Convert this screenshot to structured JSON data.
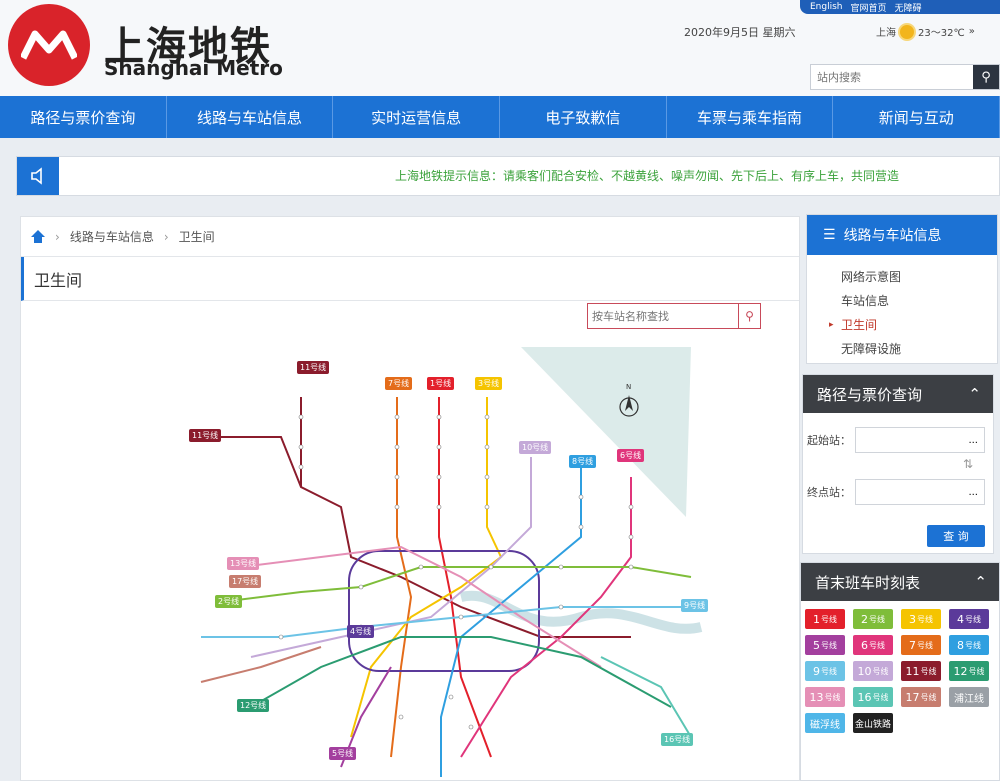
{
  "header": {
    "brand_cn": "上海地铁",
    "brand_en": "Shanghai Metro",
    "toplinks": [
      "English",
      "官网首页",
      "无障碍"
    ],
    "date": "2020年9月5日  星期六",
    "weather_city": "上海",
    "weather_temp": "23～32℃",
    "weather_more": "»",
    "search_placeholder": "站内搜索"
  },
  "nav": {
    "items": [
      "路径与票价查询",
      "线路与车站信息",
      "实时运营信息",
      "电子致歉信",
      "车票与乘车指南",
      "新闻与互动"
    ]
  },
  "notice": {
    "text": "上海地铁提示信息：请乘客们配合安检、不越黄线、噪声勿闻、先下后上、有序上车，共同营造"
  },
  "breadcrumb": [
    "线路与车站信息",
    "卫生间"
  ],
  "page_title": "卫生间",
  "station_search_placeholder": "按车站名称查找",
  "map": {
    "north": "N",
    "badges": [
      {
        "label": "11号线",
        "color": "#8b1c2c"
      },
      {
        "label": "11号线",
        "color": "#8b1c2c"
      },
      {
        "label": "7号线",
        "color": "#e46c1a"
      },
      {
        "label": "1号线",
        "color": "#e3202b"
      },
      {
        "label": "3号线",
        "color": "#f5c400"
      },
      {
        "label": "10号线",
        "color": "#c4a9d8"
      },
      {
        "label": "8号线",
        "color": "#2f9fe0"
      },
      {
        "label": "6号线",
        "color": "#e0357b"
      },
      {
        "label": "13号线",
        "color": "#e58fb6"
      },
      {
        "label": "17号线",
        "color": "#c77d6f"
      },
      {
        "label": "2号线",
        "color": "#7fbd3a"
      },
      {
        "label": "4号线",
        "color": "#5b3a9a"
      },
      {
        "label": "9号线",
        "color": "#6cc3e6"
      },
      {
        "label": "12号线",
        "color": "#2b9c71"
      },
      {
        "label": "16号线",
        "color": "#5bc5b4"
      },
      {
        "label": "5号线",
        "color": "#a33f9e"
      }
    ]
  },
  "sidebar": {
    "title": "线路与车站信息",
    "items": [
      "网络示意图",
      "车站信息",
      "卫生间",
      "无障碍设施"
    ],
    "active": "卫生间"
  },
  "route": {
    "title": "路径与票价查询",
    "start_label": "起始站：",
    "end_label": "终点站：",
    "start_value": "...",
    "end_value": "...",
    "query": "查 询"
  },
  "timetable": {
    "title": "首末班车时刻表",
    "lines": [
      {
        "num": "1",
        "suffix": "号线",
        "color": "#e3202b"
      },
      {
        "num": "2",
        "suffix": "号线",
        "color": "#7fbd3a"
      },
      {
        "num": "3",
        "suffix": "号线",
        "color": "#f5c400"
      },
      {
        "num": "4",
        "suffix": "号线",
        "color": "#5b3a9a"
      },
      {
        "num": "5",
        "suffix": "号线",
        "color": "#a33f9e"
      },
      {
        "num": "6",
        "suffix": "号线",
        "color": "#e0357b"
      },
      {
        "num": "7",
        "suffix": "号线",
        "color": "#e46c1a"
      },
      {
        "num": "8",
        "suffix": "号线",
        "color": "#2f9fe0"
      },
      {
        "num": "9",
        "suffix": "号线",
        "color": "#6cc3e6"
      },
      {
        "num": "10",
        "suffix": "号线",
        "color": "#c4a9d8"
      },
      {
        "num": "11",
        "suffix": "号线",
        "color": "#8b1c2c"
      },
      {
        "num": "12",
        "suffix": "号线",
        "color": "#2b9c71"
      },
      {
        "num": "13",
        "suffix": "号线",
        "color": "#e58fb6"
      },
      {
        "num": "16",
        "suffix": "号线",
        "color": "#5bc5b4"
      },
      {
        "num": "17",
        "suffix": "号线",
        "color": "#c77d6f"
      },
      {
        "num": "浦江线",
        "suffix": "",
        "color": "#9aa0a6"
      },
      {
        "num": "磁浮线",
        "suffix": "",
        "color": "#4fb6e8"
      },
      {
        "num": "金山铁路",
        "suffix": "",
        "color": "#222222"
      }
    ]
  }
}
